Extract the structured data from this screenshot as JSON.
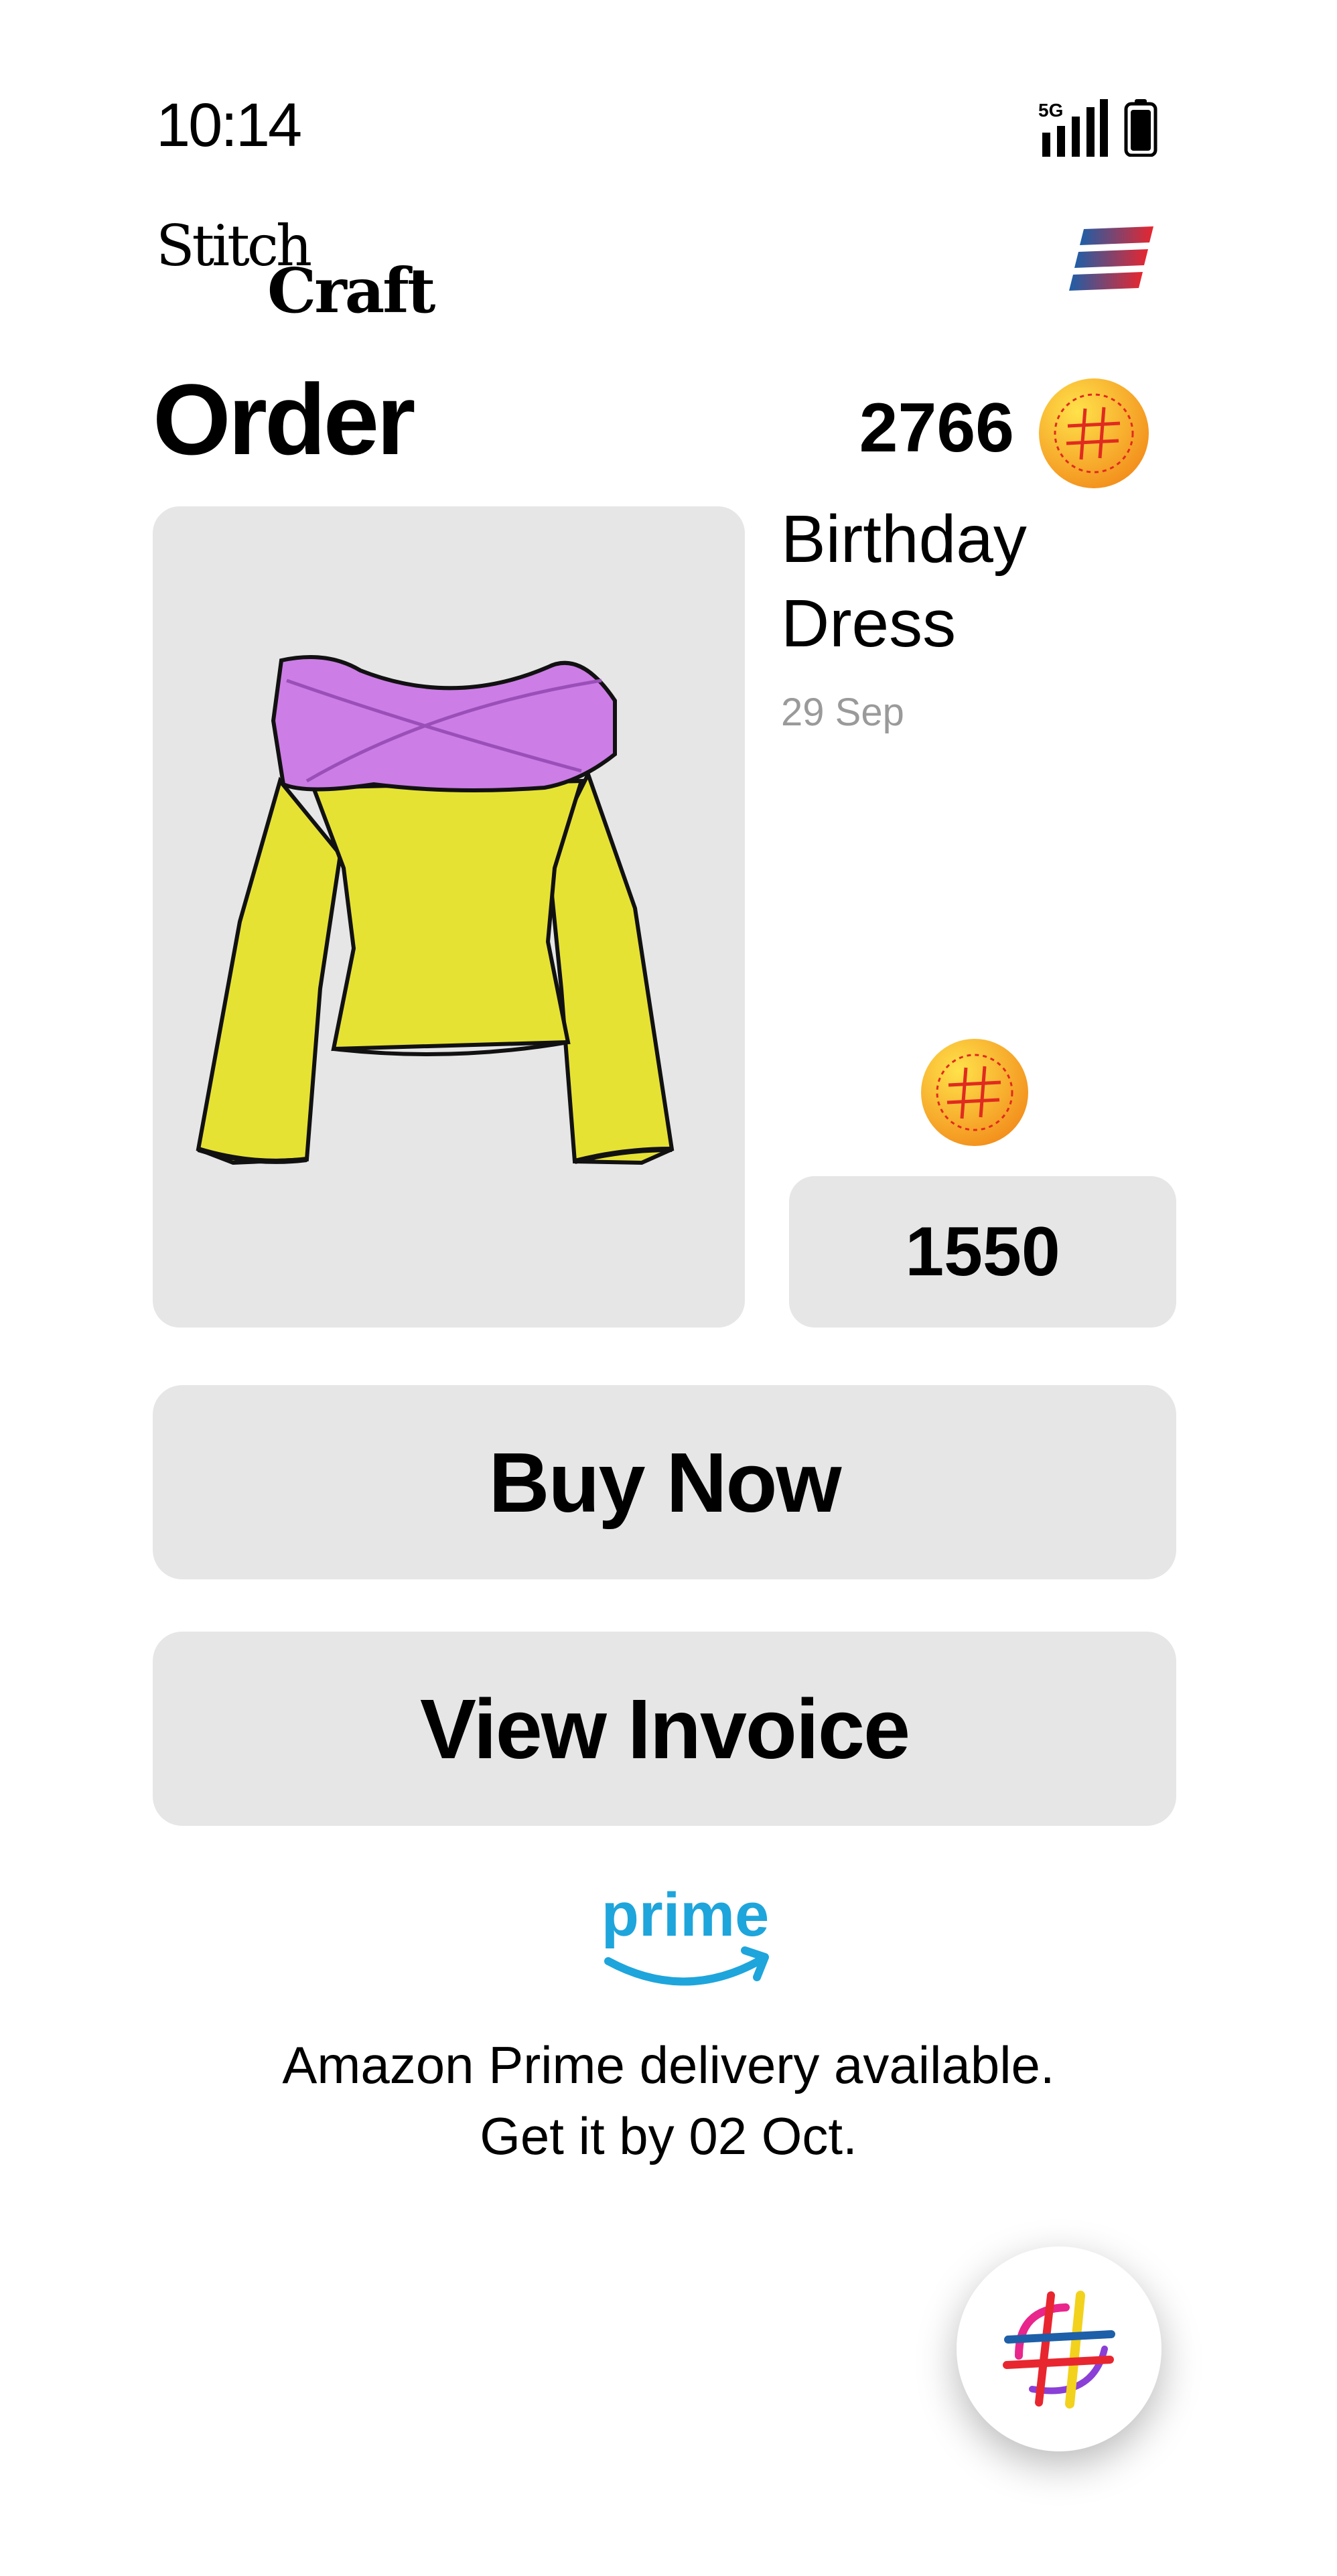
{
  "status_bar": {
    "time": "10:14",
    "network": "5G",
    "icons": [
      "signal-icon",
      "battery-icon"
    ]
  },
  "brand": {
    "line1": "Stitch",
    "line2": "Craft"
  },
  "header": {
    "title": "Order",
    "balance": "2766"
  },
  "product": {
    "name": "Birthday Dress",
    "date": "29 Sep",
    "price": "1550",
    "colors": {
      "body": "#e6e234",
      "wrap": "#cc7de6"
    }
  },
  "actions": {
    "buy_label": "Buy Now",
    "invoice_label": "View Invoice"
  },
  "delivery": {
    "brand_label": "prime",
    "line1": "Amazon Prime delivery available.",
    "line2": "Get it by 02 Oct."
  },
  "colors": {
    "card_bg": "#e6e6e6",
    "prime_blue": "#1ea5dc",
    "coin_gold": "#f0b21c",
    "coin_accent": "#e02b20"
  }
}
